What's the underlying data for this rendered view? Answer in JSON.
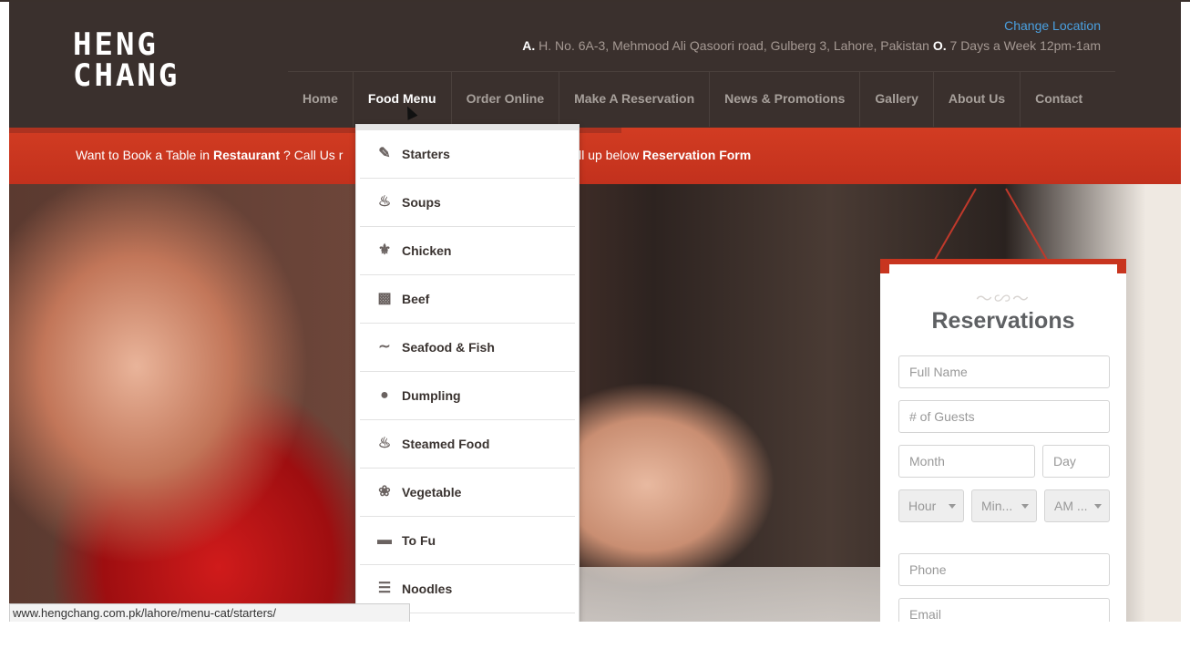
{
  "header": {
    "logo_line1": "HENG",
    "logo_line2": "CHANG",
    "change_location": "Change Location",
    "address_prefix": "A.",
    "address": "H. No. 6A-3, Mehmood Ali Qasoori road, Gulberg 3, Lahore, Pakistan",
    "hours_prefix": "O.",
    "hours": "7 Days a Week 12pm-1am"
  },
  "nav": {
    "items": [
      {
        "label": "Home"
      },
      {
        "label": "Food Menu"
      },
      {
        "label": "Order Online"
      },
      {
        "label": "Make A Reservation"
      },
      {
        "label": "News & Promotions"
      },
      {
        "label": "Gallery"
      },
      {
        "label": "About Us"
      },
      {
        "label": "Contact"
      }
    ],
    "active": "Food Menu"
  },
  "banner": {
    "text_start": "Want to Book a Table in ",
    "restaurant": "Restaurant",
    "text_mid": " ? Call Us r",
    "text_end": "ill up below ",
    "form": "Reservation Form"
  },
  "dropdown": {
    "items": [
      {
        "label": "Starters",
        "icon": "starters-icon"
      },
      {
        "label": "Soups",
        "icon": "soup-icon"
      },
      {
        "label": "Chicken",
        "icon": "chicken-icon"
      },
      {
        "label": "Beef",
        "icon": "beef-icon"
      },
      {
        "label": "Seafood & Fish",
        "icon": "fish-icon"
      },
      {
        "label": "Dumpling",
        "icon": "dumpling-icon"
      },
      {
        "label": "Steamed Food",
        "icon": "steamed-icon"
      },
      {
        "label": "Vegetable",
        "icon": "vegetable-icon"
      },
      {
        "label": "To Fu",
        "icon": "tofu-icon"
      },
      {
        "label": "Noodles",
        "icon": "noodles-icon"
      }
    ]
  },
  "reservation": {
    "title": "Reservations",
    "full_name": "Full Name",
    "guests": "# of Guests",
    "month": "Month",
    "day": "Day",
    "hour": "Hour",
    "minute": "Min...",
    "ampm": "AM ...",
    "phone": "Phone",
    "email": "Email"
  },
  "status_bar": {
    "url": "www.hengchang.com.pk/lahore/menu-cat/starters/"
  },
  "colors": {
    "header_bg": "#3a302d",
    "banner_red": "#c8351f",
    "link_blue": "#4aa0e0"
  }
}
